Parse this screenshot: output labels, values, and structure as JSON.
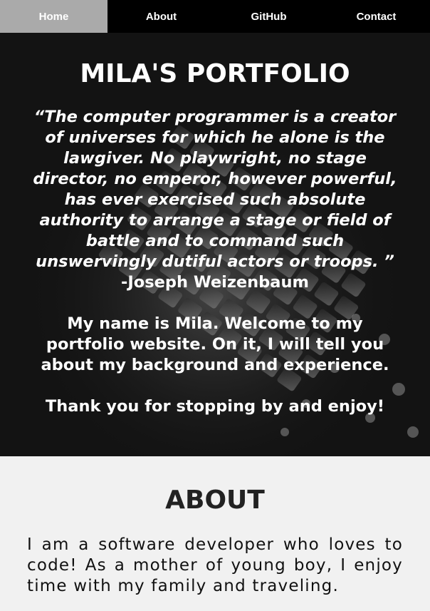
{
  "nav": {
    "items": [
      {
        "label": "Home",
        "active": true
      },
      {
        "label": "About",
        "active": false
      },
      {
        "label": "GitHub",
        "active": false
      },
      {
        "label": "Contact",
        "active": false
      }
    ]
  },
  "hero": {
    "title": "MILA'S PORTFOLIO",
    "quote": "“The computer programmer is a creator of universes for which he alone is the lawgiver. No playwright, no stage director, no emperor, however powerful, has ever exercised such absolute authority to arrange a stage or field of battle and to command such unswervingly dutiful actors or troops. ”",
    "author": "-Joseph Weizenbaum",
    "welcome": "My name is Mila. Welcome to my portfolio website. On it, I will tell you about my background and experience.",
    "thanks": "Thank you for stopping by and enjoy!",
    "background_image": "keyboard-photo",
    "background_color": "#131313"
  },
  "about": {
    "title": "ABOUT",
    "text": "I am a software developer who loves to code! As a mother of young boy, I enjoy time with my family and traveling."
  },
  "colors": {
    "nav_bg": "#000000",
    "nav_active_bg": "#aaaaaa",
    "about_bg": "#f1f1f1"
  }
}
